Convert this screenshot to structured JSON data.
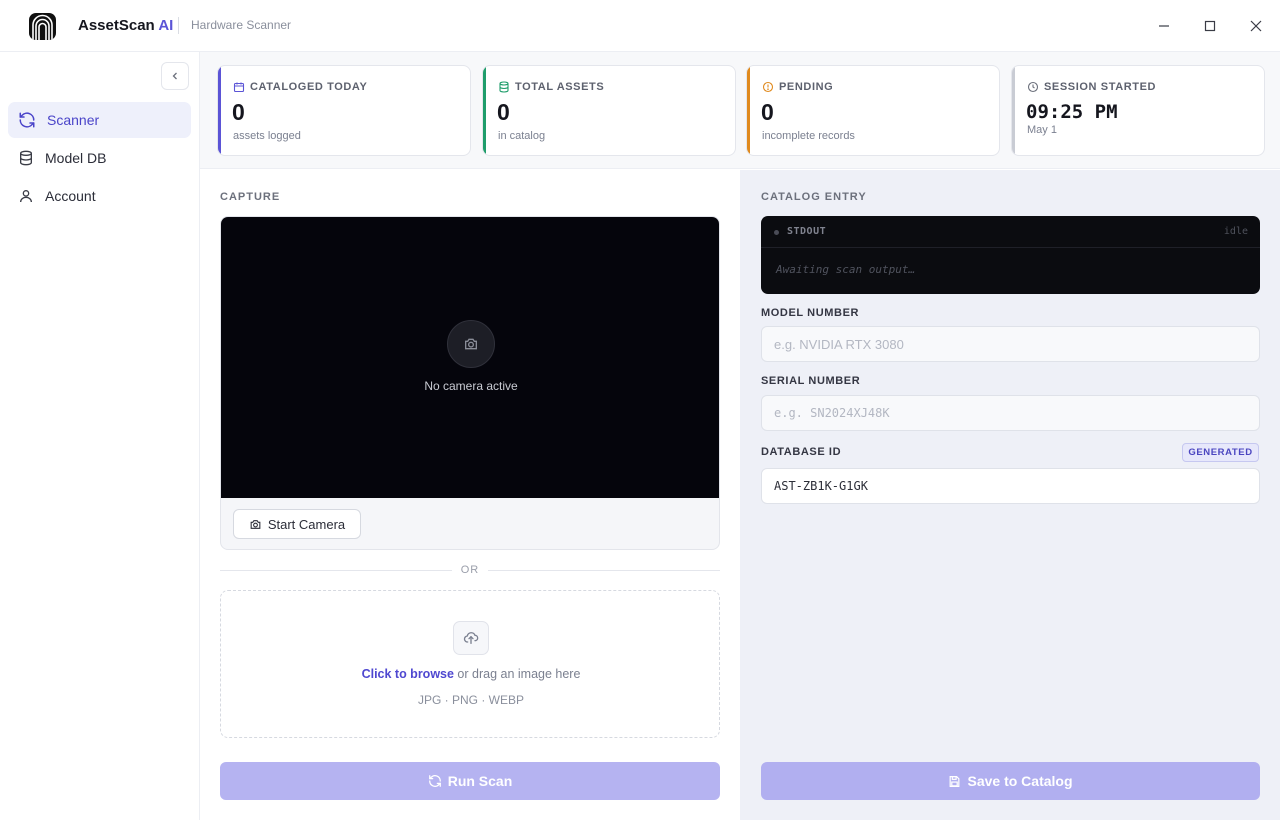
{
  "app": {
    "name": "AssetScan",
    "name_suffix": "AI",
    "subtitle": "Hardware Scanner",
    "accent_color": "#5b54d6"
  },
  "window_controls": [
    "minimize-icon",
    "maximize-icon",
    "close-icon"
  ],
  "sidebar": {
    "collapse_icon": "chevron-left-icon",
    "items": [
      {
        "label": "Scanner",
        "icon": "refresh-icon",
        "active": true
      },
      {
        "label": "Model DB",
        "icon": "database-icon",
        "active": false
      },
      {
        "label": "Account",
        "icon": "user-icon",
        "active": false
      }
    ]
  },
  "stats": [
    {
      "label": "CATALOGED TODAY",
      "value": "0",
      "sub": "assets logged",
      "icon": "calendar-icon",
      "color": "#5b54d6"
    },
    {
      "label": "TOTAL ASSETS",
      "value": "0",
      "sub": "in catalog",
      "icon": "database-icon",
      "color": "#1f9d6b"
    },
    {
      "label": "PENDING",
      "value": "0",
      "sub": "incomplete records",
      "icon": "alert-circle-icon",
      "color": "#e08a1e"
    },
    {
      "label": "SESSION STARTED",
      "value": "09:25 PM",
      "sub": "May 1",
      "icon": "clock-icon",
      "color": "#c9ccd4"
    }
  ],
  "capture": {
    "section_label": "CAPTURE",
    "camera_status": "No camera active",
    "start_camera_label": "Start Camera",
    "or_label": "OR",
    "browse_link": "Click to browse",
    "drop_text": " or drag an image here",
    "formats": "JPG · PNG · WEBP",
    "run_scan_label": "Run Scan"
  },
  "catalog": {
    "section_label": "CATALOG ENTRY",
    "terminal": {
      "label": "STDOUT",
      "status": "idle",
      "output": "Awaiting scan output…"
    },
    "model_number": {
      "label": "MODEL NUMBER",
      "placeholder": "e.g. NVIDIA RTX 3080",
      "value": ""
    },
    "serial_number": {
      "label": "SERIAL NUMBER",
      "placeholder": "e.g. SN2024XJ48K",
      "value": ""
    },
    "database_id": {
      "label": "DATABASE ID",
      "badge": "GENERATED",
      "value": "AST-ZB1K-G1GK"
    },
    "save_label": "Save to Catalog"
  }
}
